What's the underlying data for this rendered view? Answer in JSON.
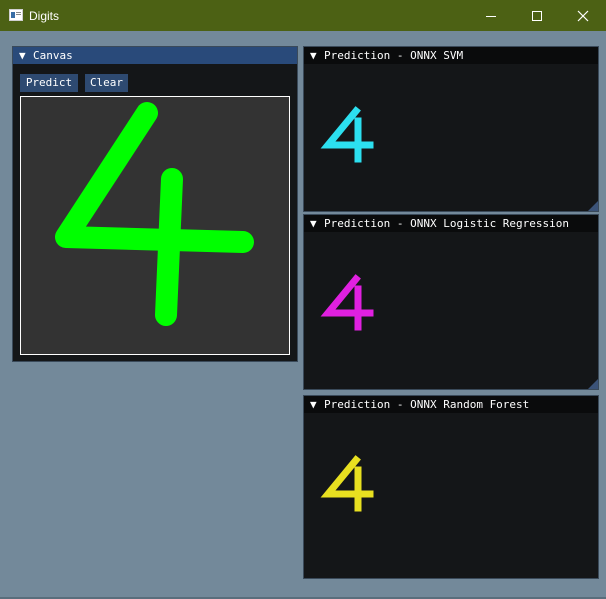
{
  "window": {
    "title": "Digits"
  },
  "canvas_panel": {
    "title": "Canvas",
    "predict_label": "Predict",
    "clear_label": "Clear",
    "stroke_color": "#00ff00"
  },
  "predictions": [
    {
      "title": "Prediction - ONNX SVM",
      "digit": "4",
      "color": "#2ce0f0"
    },
    {
      "title": "Prediction - ONNX Logistic Regression",
      "digit": "4",
      "color": "#e020e0"
    },
    {
      "title": "Prediction - ONNX Random Forest",
      "digit": "4",
      "color": "#e8e020"
    }
  ]
}
